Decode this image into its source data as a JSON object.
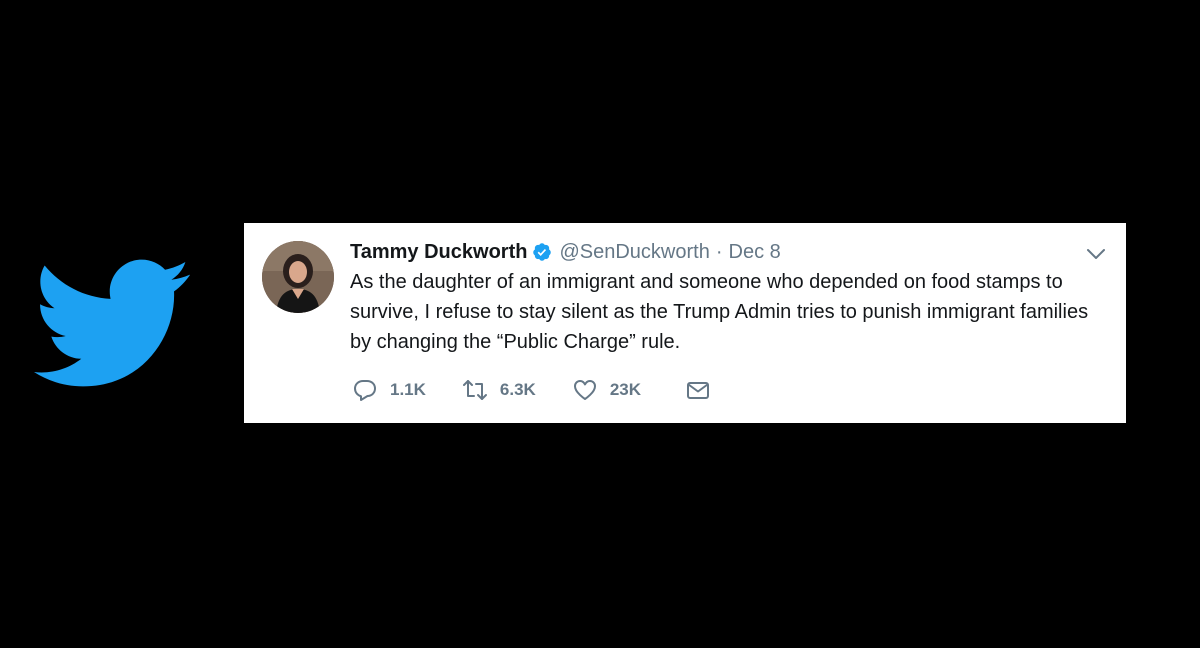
{
  "tweet": {
    "display_name": "Tammy Duckworth",
    "handle": "@SenDuckworth",
    "separator": "·",
    "date": "Dec 8",
    "text": "As the daughter of an immigrant and someone who depended on food stamps to survive, I refuse to stay silent as the Trump Admin tries to punish immigrant families by changing the “Public Charge” rule.",
    "actions": {
      "replies": "1.1K",
      "retweets": "6.3K",
      "likes": "23K"
    }
  },
  "icons": {
    "logo": "twitter-bird-icon",
    "verified": "verified-badge-icon",
    "menu": "chevron-down-icon",
    "reply": "reply-icon",
    "retweet": "retweet-icon",
    "like": "heart-icon",
    "dm": "envelope-icon"
  },
  "colors": {
    "background": "#000000",
    "brand_blue": "#1da1f2",
    "card": "#ffffff",
    "text_primary": "#14171a",
    "text_secondary": "#657786"
  }
}
